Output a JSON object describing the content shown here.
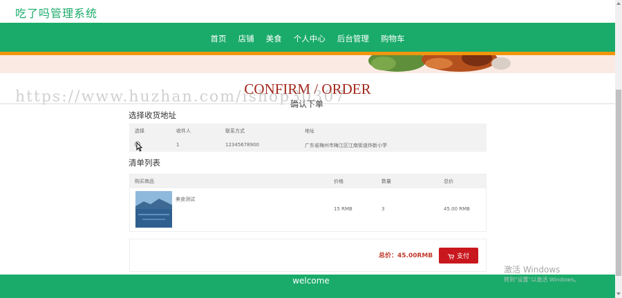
{
  "header": {
    "site_title": "吃了吗管理系统"
  },
  "nav": {
    "items": [
      "首页",
      "店铺",
      "美食",
      "个人中心",
      "后台管理",
      "购物车"
    ]
  },
  "watermark": {
    "url": "https://www.huzhan.com/ishop30307"
  },
  "page": {
    "heading_en": "CONFIRM / ORDER",
    "heading_zh": "确认下单"
  },
  "address_section": {
    "title": "选择收货地址",
    "columns": [
      "选择",
      "收件人",
      "联系方式",
      "地址"
    ],
    "row": {
      "recipient": "1",
      "phone": "12345678900",
      "address": "广东省梅州市梅江区江南街道炸新小学"
    }
  },
  "list_section": {
    "title": "清单列表",
    "columns": [
      "购买商品",
      "价格",
      "数量",
      "总价"
    ],
    "item": {
      "name": "美食测试",
      "price": "15 RMB",
      "quantity": "3",
      "total": "45.00 RMB"
    }
  },
  "summary": {
    "total_label": "总价：45.00RMB",
    "pay_label": "支付"
  },
  "footer": {
    "text": "welcome"
  },
  "os_notice": {
    "title": "激活 Windows",
    "subtitle": "转到\"设置\"以激活 Windows。"
  },
  "colors": {
    "brand_green": "#1aab6a",
    "accent_orange": "#f0960e",
    "heading_red": "#a3271b",
    "pay_red": "#c9171e"
  }
}
